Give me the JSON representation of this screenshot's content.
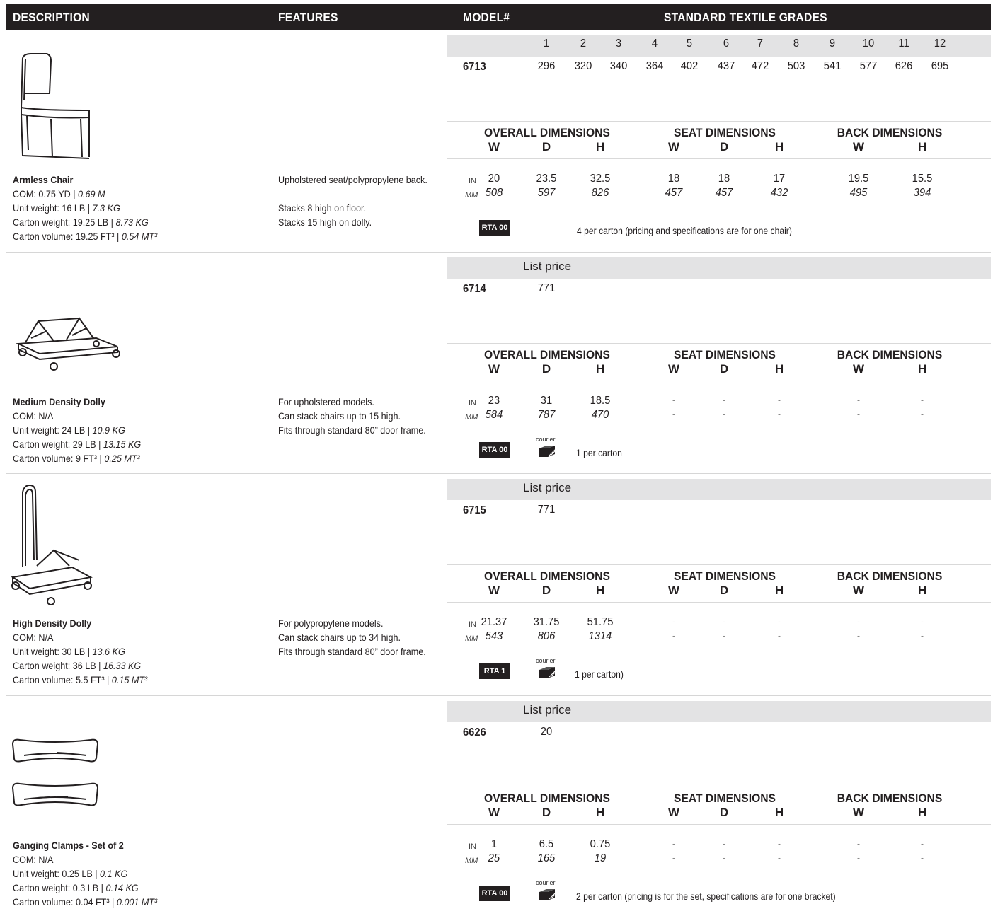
{
  "header": {
    "description": "DESCRIPTION",
    "features": "FEATURES",
    "model": "MODEL#",
    "grades": "STANDARD TEXTILE GRADES"
  },
  "grade_numbers": [
    "1",
    "2",
    "3",
    "4",
    "5",
    "6",
    "7",
    "8",
    "9",
    "10",
    "11",
    "12"
  ],
  "dim_labels": {
    "overall": "OVERALL DIMENSIONS",
    "seat": "SEAT DIMENSIONS",
    "back": "BACK DIMENSIONS",
    "w": "W",
    "d": "D",
    "h": "H",
    "in": "IN",
    "mm": "MM",
    "list_price": "List price",
    "courier": "courier"
  },
  "products": [
    {
      "name": "Armless Chair",
      "com": "COM: 0.75 YD | ",
      "com_metric": "0.69 M",
      "unit_weight": "Unit weight: 16 LB | ",
      "unit_weight_metric": "7.3 KG",
      "carton_weight": "Carton weight: 19.25 LB | ",
      "carton_weight_metric": "8.73 KG",
      "carton_volume": "Carton volume: 19.25 FT³ | ",
      "carton_volume_metric": "0.54 MT³",
      "features": [
        "Upholstered seat/polypropylene back.",
        "",
        "Stacks 8 high on floor.",
        "Stacks 15 high on dolly."
      ],
      "model": "6713",
      "prices": [
        "296",
        "320",
        "340",
        "364",
        "402",
        "437",
        "472",
        "503",
        "541",
        "577",
        "626",
        "695"
      ],
      "dims_in": [
        "20",
        "23.5",
        "32.5",
        "18",
        "18",
        "17",
        "19.5",
        "15.5"
      ],
      "dims_mm": [
        "508",
        "597",
        "826",
        "457",
        "457",
        "432",
        "495",
        "394"
      ],
      "rta": "RTA 00",
      "carton_note": "4 per carton (pricing and specifications are for one chair)",
      "icon": "armless-chair"
    },
    {
      "name": "Medium Density Dolly",
      "com": "COM: N/A",
      "unit_weight": "Unit weight: 24 LB | ",
      "unit_weight_metric": "10.9 KG",
      "carton_weight": "Carton weight: 29 LB | ",
      "carton_weight_metric": "13.15 KG",
      "carton_volume": "Carton volume: 9 FT³ | ",
      "carton_volume_metric": "0.25 MT³",
      "features": [
        "For upholstered models.",
        "Can stack chairs up to 15 high.",
        "Fits through standard 80” door frame."
      ],
      "model": "6714",
      "list_price": "771",
      "dims_in": [
        "23",
        "31",
        "18.5",
        "-",
        "-",
        "-",
        "-",
        "-"
      ],
      "dims_mm": [
        "584",
        "787",
        "470",
        "-",
        "-",
        "-",
        "-",
        "-"
      ],
      "rta": "RTA 00",
      "carton_note": "1 per carton",
      "icon": "medium-dolly"
    },
    {
      "name": "High Density Dolly",
      "com": "COM: N/A",
      "unit_weight": "Unit weight: 30 LB | ",
      "unit_weight_metric": "13.6 KG",
      "carton_weight": "Carton weight: 36 LB | ",
      "carton_weight_metric": "16.33 KG",
      "carton_volume": "Carton volume: 5.5 FT³ | ",
      "carton_volume_metric": "0.15 MT³",
      "features": [
        "For polypropylene models.",
        "Can stack chairs up to 34 high.",
        "Fits through standard 80” door frame."
      ],
      "model": "6715",
      "list_price": "771",
      "dims_in": [
        "21.37",
        "31.75",
        "51.75",
        "-",
        "-",
        "-",
        "-",
        "-"
      ],
      "dims_mm": [
        "543",
        "806",
        "1314",
        "-",
        "-",
        "-",
        "-",
        "-"
      ],
      "rta": "RTA 1",
      "carton_note": "1 per carton)",
      "icon": "high-dolly"
    },
    {
      "name": "Ganging Clamps - Set of 2",
      "com": "COM: N/A",
      "unit_weight": "Unit weight: 0.25 LB | ",
      "unit_weight_metric": "0.1 KG",
      "carton_weight": "Carton weight: 0.3 LB | ",
      "carton_weight_metric": "0.14 KG",
      "carton_volume": "Carton volume: 0.04 FT³ | ",
      "carton_volume_metric": "0.001 MT³",
      "features": [],
      "model": "6626",
      "list_price": "20",
      "dims_in": [
        "1",
        "6.5",
        "0.75",
        "-",
        "-",
        "-",
        "-",
        "-"
      ],
      "dims_mm": [
        "25",
        "165",
        "19",
        "-",
        "-",
        "-",
        "-",
        "-"
      ],
      "rta": "RTA 00",
      "carton_note": "2 per carton (pricing is for the set, specifications are for one bracket)",
      "icon": "ganging-clamp"
    }
  ]
}
